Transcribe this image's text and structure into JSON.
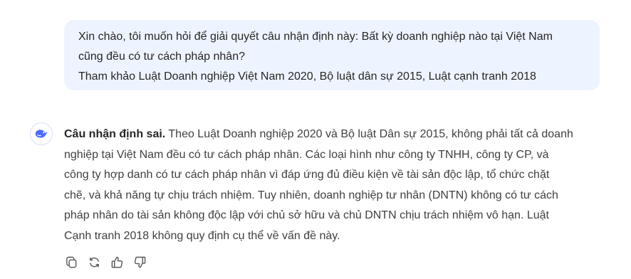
{
  "user_message": {
    "lines": [
      "Xin chào, tôi muốn hỏi để giải quyết câu nhận định này: Bất kỳ doanh nghiệp nào tại Việt Nam",
      "cũng đều có tư cách pháp nhân?",
      "Tham khảo Luật Doanh nghiệp Việt Nam 2020, Bộ luật dân sự 2015, Luật cạnh tranh 2018"
    ]
  },
  "assistant": {
    "avatar_icon": "whale-logo-icon",
    "bold_lead": "Câu nhận định sai.",
    "first_line_rest": " Theo Luật Doanh nghiệp 2020 và Bộ luật Dân sự 2015, không phải tất cả doanh",
    "lines": [
      "nghiệp tại Việt Nam đều có tư cách pháp nhân. Các loại hình như công ty TNHH, công ty CP, và",
      "công ty hợp danh có tư cách pháp nhân vì đáp ứng đủ điều kiện về tài sản độc lập, tổ chức chặt",
      "chẽ, và khả năng tự chịu trách nhiệm. Tuy nhiên, doanh nghiệp tư nhân (DNTN) không có tư cách",
      "pháp nhân do tài sản không độc lập với chủ sở hữu và chủ DNTN chịu trách nhiệm vô hạn. Luật",
      "Cạnh tranh 2018 không quy định cụ thể về vấn đề này."
    ]
  },
  "actions": {
    "icons": [
      "copy-icon",
      "regenerate-icon",
      "thumbs-up-icon",
      "thumbs-down-icon"
    ]
  },
  "colors": {
    "bubble_bg": "#eef4ff",
    "brand_blue": "#4d6bfe",
    "icon_gray": "#595959"
  }
}
